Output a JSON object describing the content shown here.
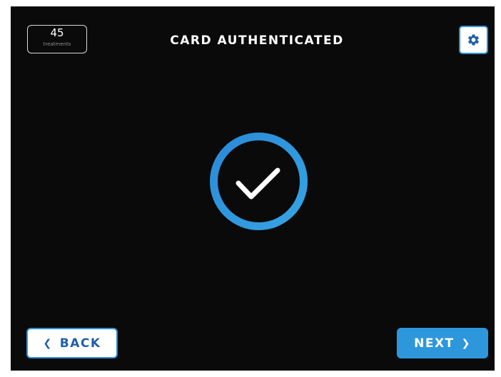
{
  "header": {
    "counter_value": "45",
    "counter_label": "treatments",
    "title": "CARD AUTHENTICATED",
    "settings_icon": "gear-icon"
  },
  "status": {
    "icon": "checkmark-circle-icon",
    "ring_color": "#2e97dc",
    "check_color": "#ffffff"
  },
  "footer": {
    "back_label": "BACK",
    "back_icon": "chevron-left-icon",
    "next_label": "NEXT",
    "next_icon": "chevron-right-icon"
  },
  "colors": {
    "background": "#0a0a0a",
    "accent": "#2e97dc",
    "back_text": "#1f5fa6"
  }
}
